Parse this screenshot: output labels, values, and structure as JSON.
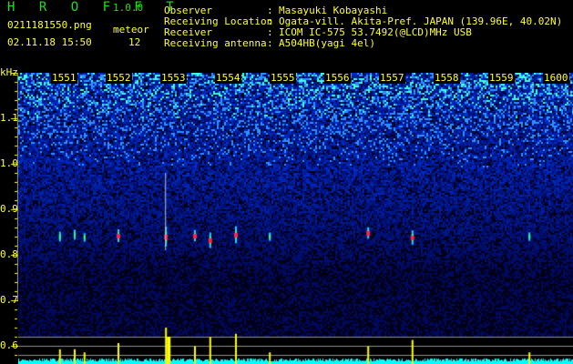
{
  "header": {
    "app_name": "H R O F F T",
    "version": "1.0.0",
    "filename": "0211181550.png",
    "datetime": "02.11.18 15:50",
    "meteor_label": "meteor",
    "meteor_count": "12"
  },
  "info": [
    {
      "label": "Observer",
      "value": "Masayuki Kobayashi"
    },
    {
      "label": "Receiving Location",
      "value": "Ogata-vill. Akita-Pref. JAPAN (139.96E, 40.02N)"
    },
    {
      "label": "Receiver",
      "value": "ICOM IC-575 53.7492(@LCD)MHz USB"
    },
    {
      "label": "Receiving antenna",
      "value": "A504HB(yagi 4el)"
    }
  ],
  "axis": {
    "unit": "kHz",
    "y_ticks": [
      "1.1",
      "1.0",
      "0.9",
      "0.8",
      "0.7",
      "0.6"
    ],
    "x_ticks": [
      "1551",
      "1552",
      "1553",
      "1554",
      "1555",
      "1556",
      "1557",
      "1558",
      "1559",
      "1600"
    ]
  },
  "colors": {
    "background": "#000000",
    "text": "#ffff33",
    "title": "#22dd22",
    "histogram": "#00ffff",
    "meteor_bar": "#ffff00"
  },
  "meteors": [
    {
      "min": 0.78,
      "khz": 0.76,
      "strength": 0.3
    },
    {
      "min": 1.05,
      "khz": 0.764,
      "strength": 0.3
    },
    {
      "min": 1.23,
      "khz": 0.758,
      "strength": 0.2
    },
    {
      "min": 1.85,
      "khz": 0.762,
      "strength": 0.5
    },
    {
      "min": 2.72,
      "khz": 0.76,
      "strength": 1.0
    },
    {
      "min": 3.25,
      "khz": 0.762,
      "strength": 0.4
    },
    {
      "min": 3.53,
      "khz": 0.752,
      "strength": 0.7
    },
    {
      "min": 4.0,
      "khz": 0.764,
      "strength": 0.8
    },
    {
      "min": 4.62,
      "khz": 0.76,
      "strength": 0.2
    },
    {
      "min": 6.42,
      "khz": 0.768,
      "strength": 0.4
    },
    {
      "min": 7.23,
      "khz": 0.758,
      "strength": 0.6
    },
    {
      "min": 9.37,
      "khz": 0.76,
      "strength": 0.2
    }
  ]
}
